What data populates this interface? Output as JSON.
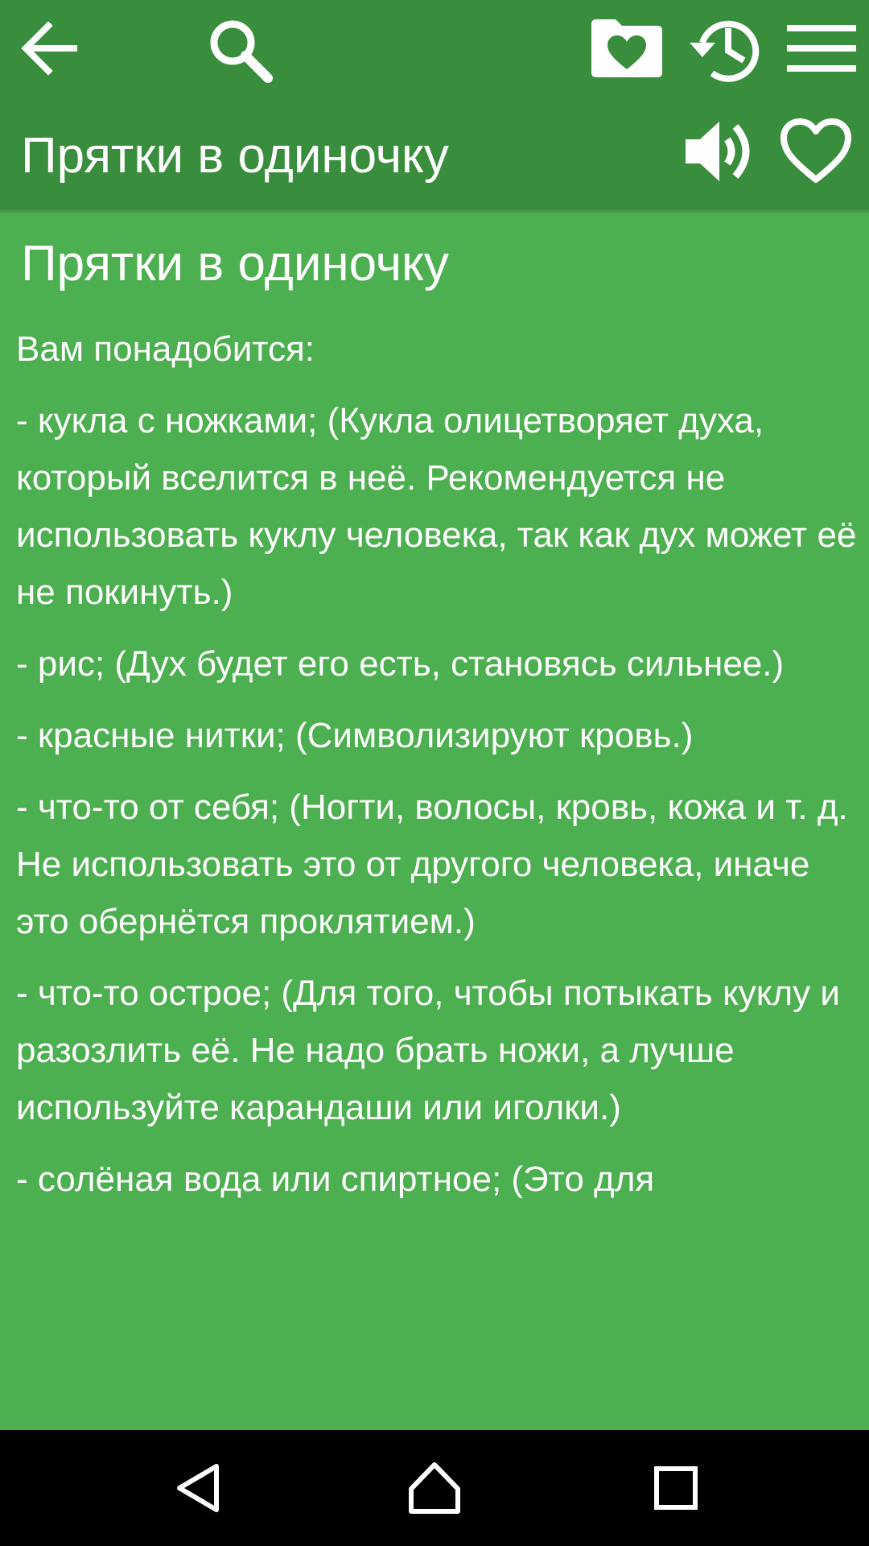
{
  "toolbar": {
    "icons": {
      "back": "arrow-left-icon",
      "search": "search-icon",
      "favorites_folder": "folder-heart-icon",
      "history": "history-icon",
      "menu": "hamburger-menu-icon",
      "speak": "speaker-icon",
      "favorite": "heart-outline-icon"
    },
    "title": "Прятки в одиночку"
  },
  "article": {
    "title": "Прятки в одиночку",
    "paragraphs": [
      "Вам понадобится:",
      "- кукла с ножками; (Кукла олицетворяет духа, который вселится в неё. Рекомендуется не использовать куклу человека, так как дух может её не покинуть.)",
      "- рис; (Дух будет его есть, становясь сильнее.)",
      "- красные нитки; (Символизируют кровь.)",
      "- что-то от себя; (Ногти, волосы, кровь, кожа и т. д. Не использовать это от другого человека, иначе это обернётся проклятием.)",
      "- что-то острое; (Для того, чтобы потыкать куклу и разозлить её. Не надо брать ножи, а лучше используйте карандаши или иголки.)",
      "- солёная вода или спиртное; (Это для"
    ]
  },
  "navbar": {
    "icons": {
      "back": "nav-back-triangle-icon",
      "home": "nav-home-icon",
      "recents": "nav-recents-square-icon"
    }
  },
  "colors": {
    "toolbar": "#388e3c",
    "content": "#4caf50",
    "text": "#ffffff",
    "navbar": "#000000"
  }
}
